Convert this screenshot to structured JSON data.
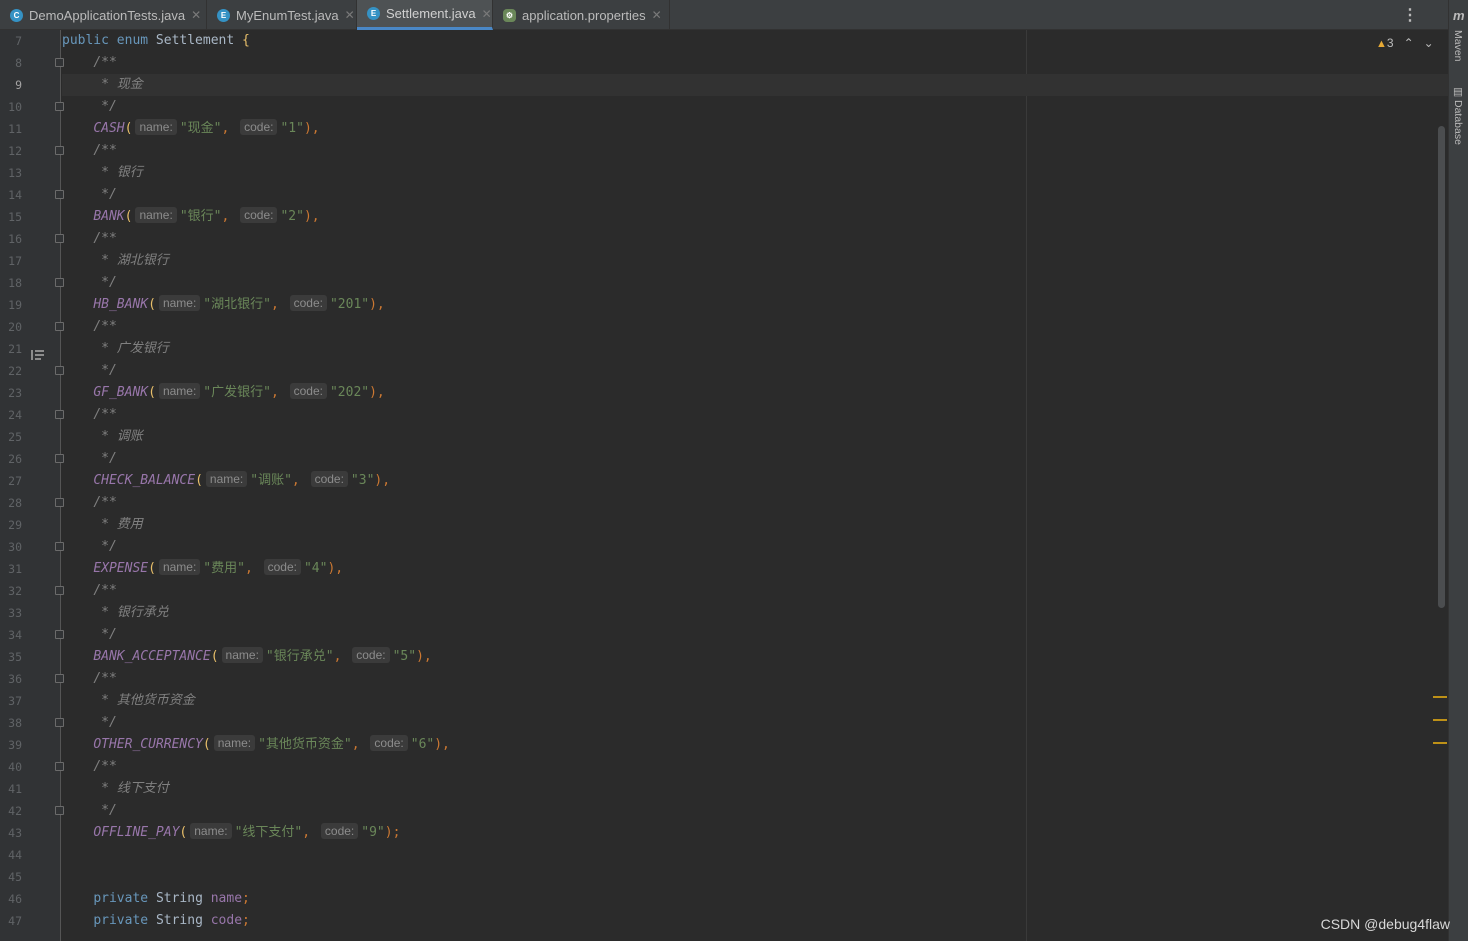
{
  "tabs": [
    {
      "label": "DemoApplicationTests.java",
      "icon": "class-icon",
      "color": "#3592c4"
    },
    {
      "label": "MyEnumTest.java",
      "icon": "enum-icon",
      "color": "#3592c4"
    },
    {
      "label": "Settlement.java",
      "icon": "enum-icon",
      "color": "#3592c4"
    },
    {
      "label": "application.properties",
      "icon": "spring-properties-icon",
      "color": "#6a8759"
    }
  ],
  "current_line": 9,
  "inspections": {
    "warnings": "3"
  },
  "right_toolbar": {
    "maven": "Maven",
    "database": "Database"
  },
  "watermark": "CSDN @debug4flaw",
  "code": {
    "l7": {
      "a": "public enum ",
      "b": "Settlement ",
      "c": "{"
    },
    "l8": "/**",
    "l9": " * 现金",
    "l10": " */",
    "l11": {
      "name": "CASH",
      "h1": "name:",
      "v1": "\"现金\"",
      "h2": "code:",
      "v2": "\"1\"",
      "end": "),"
    },
    "l12": "/**",
    "l13": " * 银行",
    "l14": " */",
    "l15": {
      "name": "BANK",
      "h1": "name:",
      "v1": "\"银行\"",
      "h2": "code:",
      "v2": "\"2\"",
      "end": "),"
    },
    "l16": "/**",
    "l17": " * 湖北银行",
    "l18": " */",
    "l19": {
      "name": "HB_BANK",
      "h1": "name:",
      "v1": "\"湖北银行\"",
      "h2": "code:",
      "v2": "\"201\"",
      "end": "),"
    },
    "l20": "/**",
    "l21": " * 广发银行",
    "l22": " */",
    "l23": {
      "name": "GF_BANK",
      "h1": "name:",
      "v1": "\"广发银行\"",
      "h2": "code:",
      "v2": "\"202\"",
      "end": "),"
    },
    "l24": "/**",
    "l25": " * 调账",
    "l26": " */",
    "l27": {
      "name": "CHECK_BALANCE",
      "h1": "name:",
      "v1": "\"调账\"",
      "h2": "code:",
      "v2": "\"3\"",
      "end": "),"
    },
    "l28": "/**",
    "l29": " * 费用",
    "l30": " */",
    "l31": {
      "name": "EXPENSE",
      "h1": "name:",
      "v1": "\"费用\"",
      "h2": "code:",
      "v2": "\"4\"",
      "end": "),"
    },
    "l32": "/**",
    "l33": " * 银行承兑",
    "l34": " */",
    "l35": {
      "name": "BANK_ACCEPTANCE",
      "h1": "name:",
      "v1": "\"银行承兑\"",
      "h2": "code:",
      "v2": "\"5\"",
      "end": "),"
    },
    "l36": "/**",
    "l37": " * 其他货币资金",
    "l38": " */",
    "l39": {
      "name": "OTHER_CURRENCY",
      "h1": "name:",
      "v1": "\"其他货币资金\"",
      "h2": "code:",
      "v2": "\"6\"",
      "end": "),"
    },
    "l40": "/**",
    "l41": " * 线下支付",
    "l42": " */",
    "l43": {
      "name": "OFFLINE_PAY",
      "h1": "name:",
      "v1": "\"线下支付\"",
      "h2": "code:",
      "v2": "\"9\"",
      "end": ");"
    },
    "l46": {
      "kw": "private ",
      "type": "String ",
      "field": "name",
      "end": ";"
    },
    "l47": {
      "kw": "private ",
      "type": "String ",
      "field": "code",
      "end": ";"
    }
  }
}
